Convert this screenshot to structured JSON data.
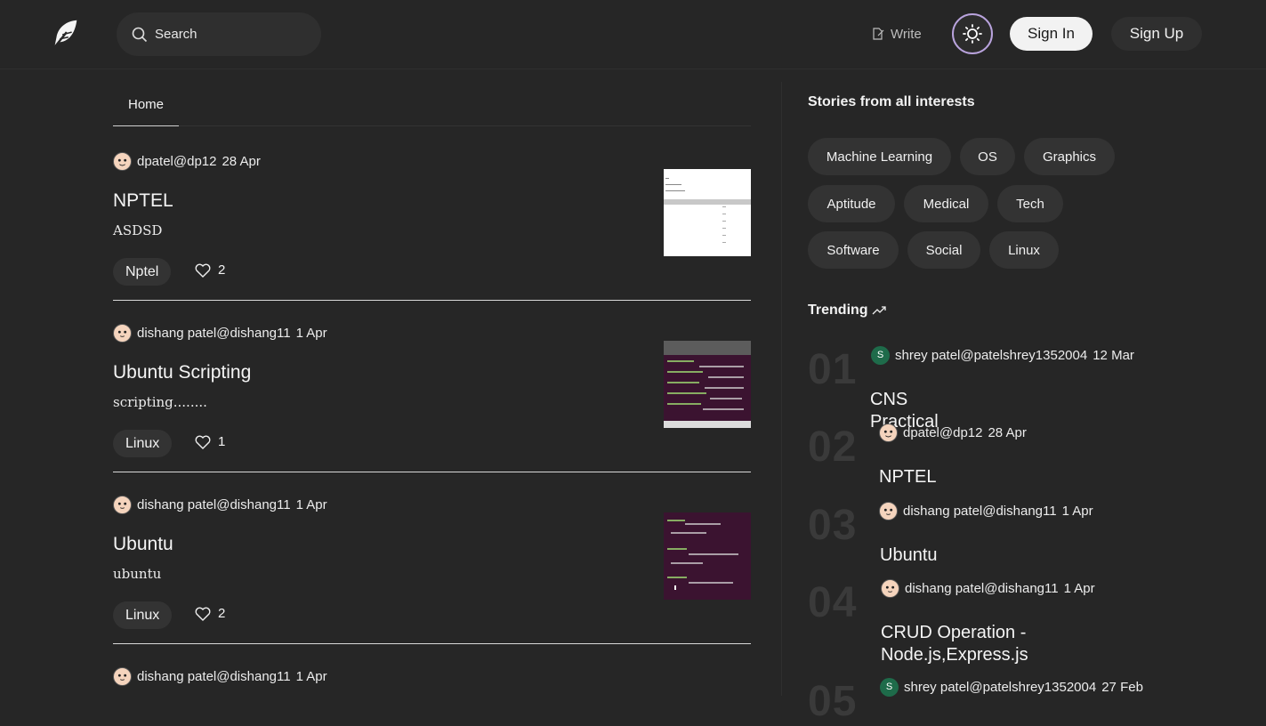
{
  "header": {
    "search_placeholder": "Search",
    "write_label": "Write",
    "signin_label": "Sign In",
    "signup_label": "Sign Up"
  },
  "tabs": [
    {
      "label": "Home"
    }
  ],
  "posts": [
    {
      "author": "dpatel@dp12",
      "date": "28 Apr",
      "title": "NPTEL",
      "excerpt": "ASDSD",
      "tag": "Nptel",
      "likes": "2"
    },
    {
      "author": "dishang patel@dishang11",
      "date": "1 Apr",
      "title": "Ubuntu Scripting",
      "excerpt": "scripting........",
      "tag": "Linux",
      "likes": "1"
    },
    {
      "author": "dishang patel@dishang11",
      "date": "1 Apr",
      "title": "Ubuntu",
      "excerpt": "ubuntu",
      "tag": "Linux",
      "likes": "2"
    },
    {
      "author": "dishang patel@dishang11",
      "date": "1 Apr"
    }
  ],
  "sidebar": {
    "interests_title": "Stories from all interests",
    "interests": [
      "Machine Learning",
      "OS",
      "Graphics",
      "Aptitude",
      "Medical",
      "Tech",
      "Software",
      "Social",
      "Linux"
    ],
    "trending_title": "Trending",
    "trending": [
      {
        "num": "01",
        "avatar_letter": "S",
        "author": "shrey patel@patelshrey1352004",
        "date": "12 Mar",
        "title": "CNS Practical"
      },
      {
        "num": "02",
        "author": "dpatel@dp12",
        "date": "28 Apr",
        "title": "NPTEL"
      },
      {
        "num": "03",
        "author": "dishang patel@dishang11",
        "date": "1 Apr",
        "title": "Ubuntu"
      },
      {
        "num": "04",
        "author": "dishang patel@dishang11",
        "date": "1 Apr",
        "title": "CRUD Operation - Node.js,Express.js"
      },
      {
        "num": "05",
        "avatar_letter": "S",
        "author": "shrey patel@patelshrey1352004",
        "date": "27 Feb"
      }
    ]
  },
  "colors": {
    "background": "#262626",
    "accent": "#b9a3dd",
    "chip": "#333333"
  }
}
